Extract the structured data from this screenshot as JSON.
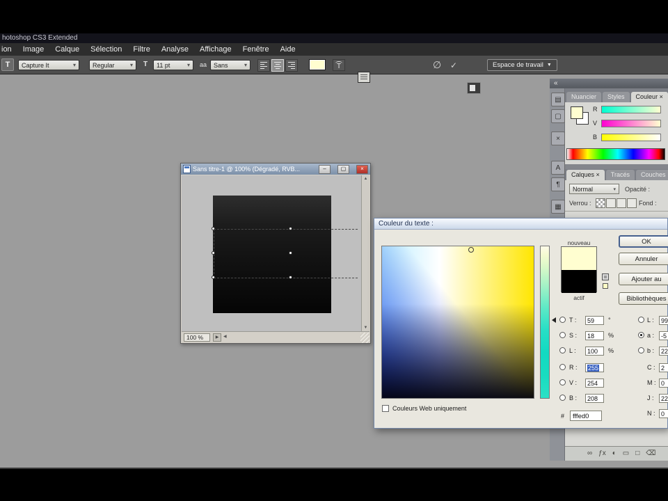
{
  "icons": {
    "collapse": "«",
    "dropdown": "▾",
    "scroll_up": "▲",
    "scroll_down": "▼",
    "scroll_left": "◀",
    "scroll_right": "▶",
    "minimize": "–",
    "maximize": "▢",
    "close": "×",
    "cancel": "∅",
    "commit": "✓"
  },
  "window": {
    "title": "hotoshop CS3 Extended"
  },
  "menu": {
    "items": [
      "ion",
      "Image",
      "Calque",
      "Sélection",
      "Filtre",
      "Analyse",
      "Affichage",
      "Fenêtre",
      "Aide"
    ]
  },
  "options": {
    "tool_icon": "T",
    "preset": "Capture It",
    "style": "Regular",
    "size_icon": "T",
    "size": "11 pt",
    "aa_label": "aa",
    "aa": "Sans",
    "workspace": "Espace de travail"
  },
  "doc": {
    "title": "Sans titre-1 @ 100% (Dégradé, RVB...",
    "zoom": "100 %"
  },
  "picker": {
    "title": "Couleur du texte :",
    "new_label": "nouveau",
    "current_label": "actif",
    "ok": "OK",
    "cancel": "Annuler",
    "add": "Ajouter au",
    "libraries": "Bibliothèques",
    "web_only": "Couleurs Web uniquement",
    "hex_label": "#",
    "hex": "fffed0",
    "left_fields": [
      {
        "label": "T :",
        "value": "59",
        "unit": "°"
      },
      {
        "label": "S :",
        "value": "18",
        "unit": "%"
      },
      {
        "label": "L :",
        "value": "100",
        "unit": "%"
      },
      {
        "label": "R :",
        "value": "255"
      },
      {
        "label": "V :",
        "value": "254"
      },
      {
        "label": "B :",
        "value": "208"
      }
    ],
    "right_fields": [
      {
        "label": "L :",
        "value": "99"
      },
      {
        "label": "a :",
        "value": "-5"
      },
      {
        "label": "b :",
        "value": "22"
      },
      {
        "label": "C :",
        "value": "2"
      },
      {
        "label": "M :",
        "value": "0"
      },
      {
        "label": "J :",
        "value": "22"
      },
      {
        "label": "N :",
        "value": "0"
      }
    ]
  },
  "panels": {
    "dock_icons": [
      "▤",
      "▢",
      "×",
      "A",
      "¶",
      "▦"
    ],
    "color_tabs": [
      "Nuancier",
      "Styles",
      "Couleur ×"
    ],
    "sliders": [
      "R",
      "V",
      "B"
    ],
    "layer_tabs": [
      "Calques ×",
      "Tracés",
      "Couches"
    ],
    "blend_mode": "Normal",
    "opacity_label": "Opacité :",
    "lock_label": "Verrou :",
    "fill_label": "Fond :",
    "bottom_icons": [
      "∞",
      "ƒx",
      "◐",
      "▭",
      "□",
      "⌫"
    ]
  },
  "colors": {
    "picked_hex": "#fffed0",
    "workspace_bg": "#9c9c9c",
    "close_button": "#c0392b"
  }
}
